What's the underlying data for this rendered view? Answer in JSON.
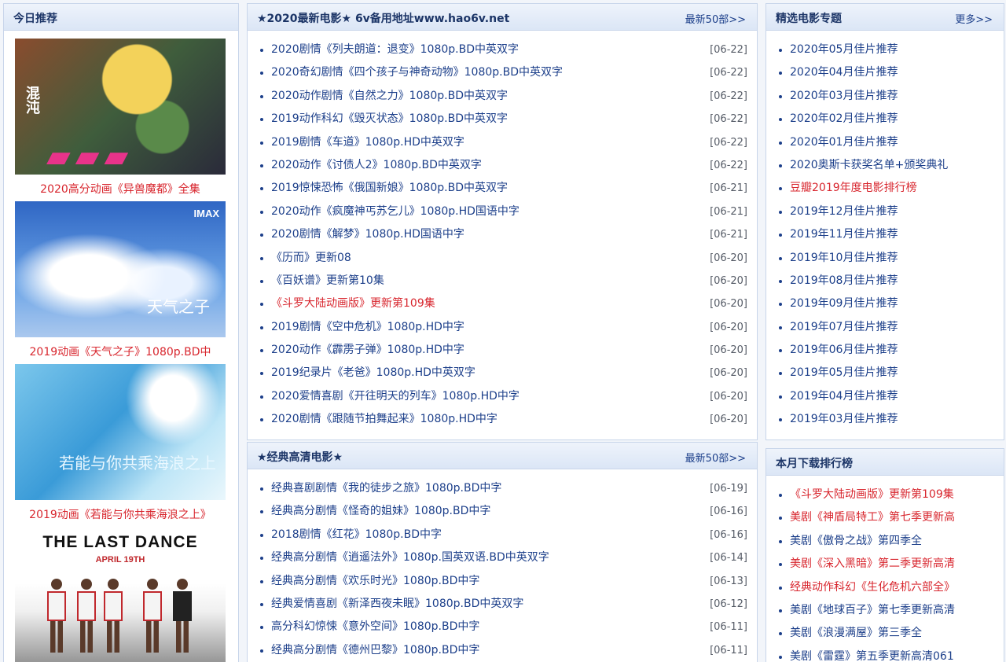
{
  "left": {
    "header": "今日推荐",
    "posters": [
      {
        "caption": "2020高分动画《异兽魔都》全集",
        "art_text_vertical": "混沌"
      },
      {
        "caption": "2019动画《天气之子》1080p.BD中",
        "badge": "IMAX",
        "art_title": "天气之子"
      },
      {
        "caption": "2019动画《若能与你共乘海浪之上》",
        "art_title": "若能与你共乘海浪之上"
      },
      {
        "caption": "",
        "art_title": "THE LAST DANCE",
        "art_date": "APRIL 19TH"
      }
    ]
  },
  "new_movies": {
    "header": "★2020最新电影★ 6v备用地址www.hao6v.net",
    "more": "最新50部>>",
    "items": [
      {
        "title": "2020剧情《列夫朗道：退变》1080p.BD中英双字",
        "date": "[06-22]"
      },
      {
        "title": "2020奇幻剧情《四个孩子与神奇动物》1080p.BD中英双字",
        "date": "[06-22]"
      },
      {
        "title": "2020动作剧情《自然之力》1080p.BD中英双字",
        "date": "[06-22]"
      },
      {
        "title": "2019动作科幻《毁灭状态》1080p.BD中英双字",
        "date": "[06-22]"
      },
      {
        "title": "2019剧情《车道》1080p.HD中英双字",
        "date": "[06-22]"
      },
      {
        "title": "2020动作《讨债人2》1080p.BD中英双字",
        "date": "[06-22]"
      },
      {
        "title": "2019惊悚恐怖《俄国新娘》1080p.BD中英双字",
        "date": "[06-21]"
      },
      {
        "title": "2020动作《疯魔神丐苏乞儿》1080p.HD国语中字",
        "date": "[06-21]"
      },
      {
        "title": "2020剧情《解梦》1080p.HD国语中字",
        "date": "[06-21]"
      },
      {
        "title": "《历而》更新08",
        "date": "[06-20]"
      },
      {
        "title": "《百妖谱》更新第10集",
        "date": "[06-20]"
      },
      {
        "title": "《斗罗大陆动画版》更新第109集",
        "date": "[06-20]",
        "highlight": true
      },
      {
        "title": "2019剧情《空中危机》1080p.HD中字",
        "date": "[06-20]"
      },
      {
        "title": "2020动作《霹雳子弹》1080p.HD中字",
        "date": "[06-20]"
      },
      {
        "title": "2019纪录片《老爸》1080p.HD中英双字",
        "date": "[06-20]"
      },
      {
        "title": "2020爱情喜剧《开往明天的列车》1080p.HD中字",
        "date": "[06-20]"
      },
      {
        "title": "2020剧情《跟随节拍舞起来》1080p.HD中字",
        "date": "[06-20]"
      }
    ]
  },
  "classic": {
    "header": "★经典高清电影★",
    "more": "最新50部>>",
    "items": [
      {
        "title": "经典喜剧剧情《我的徒步之旅》1080p.BD中字",
        "date": "[06-19]"
      },
      {
        "title": "经典高分剧情《怪奇的姐妹》1080p.BD中字",
        "date": "[06-16]"
      },
      {
        "title": "2018剧情《红花》1080p.BD中字",
        "date": "[06-16]"
      },
      {
        "title": "经典高分剧情《逍遥法外》1080p.国英双语.BD中英双字",
        "date": "[06-14]"
      },
      {
        "title": "经典高分剧情《欢乐时光》1080p.BD中字",
        "date": "[06-13]"
      },
      {
        "title": "经典爱情喜剧《新泽西夜未眠》1080p.BD中英双字",
        "date": "[06-12]"
      },
      {
        "title": "高分科幻惊悚《意外空间》1080p.BD中字",
        "date": "[06-11]"
      },
      {
        "title": "经典高分剧情《德州巴黎》1080p.BD中字",
        "date": "[06-11]"
      }
    ]
  },
  "topics": {
    "header": "精选电影专题",
    "more": "更多>>",
    "items": [
      {
        "title": "2020年05月佳片推荐"
      },
      {
        "title": "2020年04月佳片推荐"
      },
      {
        "title": "2020年03月佳片推荐"
      },
      {
        "title": "2020年02月佳片推荐"
      },
      {
        "title": "2020年01月佳片推荐"
      },
      {
        "title": "2020奥斯卡获奖名单+颁奖典礼"
      },
      {
        "title": "豆瓣2019年度电影排行榜",
        "highlight": true
      },
      {
        "title": "2019年12月佳片推荐"
      },
      {
        "title": "2019年11月佳片推荐"
      },
      {
        "title": "2019年10月佳片推荐"
      },
      {
        "title": "2019年08月佳片推荐"
      },
      {
        "title": "2019年09月佳片推荐"
      },
      {
        "title": "2019年07月佳片推荐"
      },
      {
        "title": "2019年06月佳片推荐"
      },
      {
        "title": "2019年05月佳片推荐"
      },
      {
        "title": "2019年04月佳片推荐"
      },
      {
        "title": "2019年03月佳片推荐"
      }
    ]
  },
  "ranking": {
    "header": "本月下载排行榜",
    "items": [
      {
        "title": "《斗罗大陆动画版》更新第109集",
        "highlight": true
      },
      {
        "title": "美剧《神盾局特工》第七季更新高",
        "highlight": true
      },
      {
        "title": "美剧《傲骨之战》第四季全"
      },
      {
        "title": "美剧《深入黑暗》第二季更新高清",
        "highlight": true
      },
      {
        "title": "经典动作科幻《生化危机六部全》",
        "highlight": true
      },
      {
        "title": "美剧《地球百子》第七季更新高清"
      },
      {
        "title": "美剧《浪漫满屋》第三季全"
      },
      {
        "title": "美剧《雷霆》第五季更新高清061"
      }
    ]
  },
  "colors": {
    "link": "#1c3f8a",
    "highlight": "#d8262e",
    "header_bg": "#dbe6f6"
  }
}
